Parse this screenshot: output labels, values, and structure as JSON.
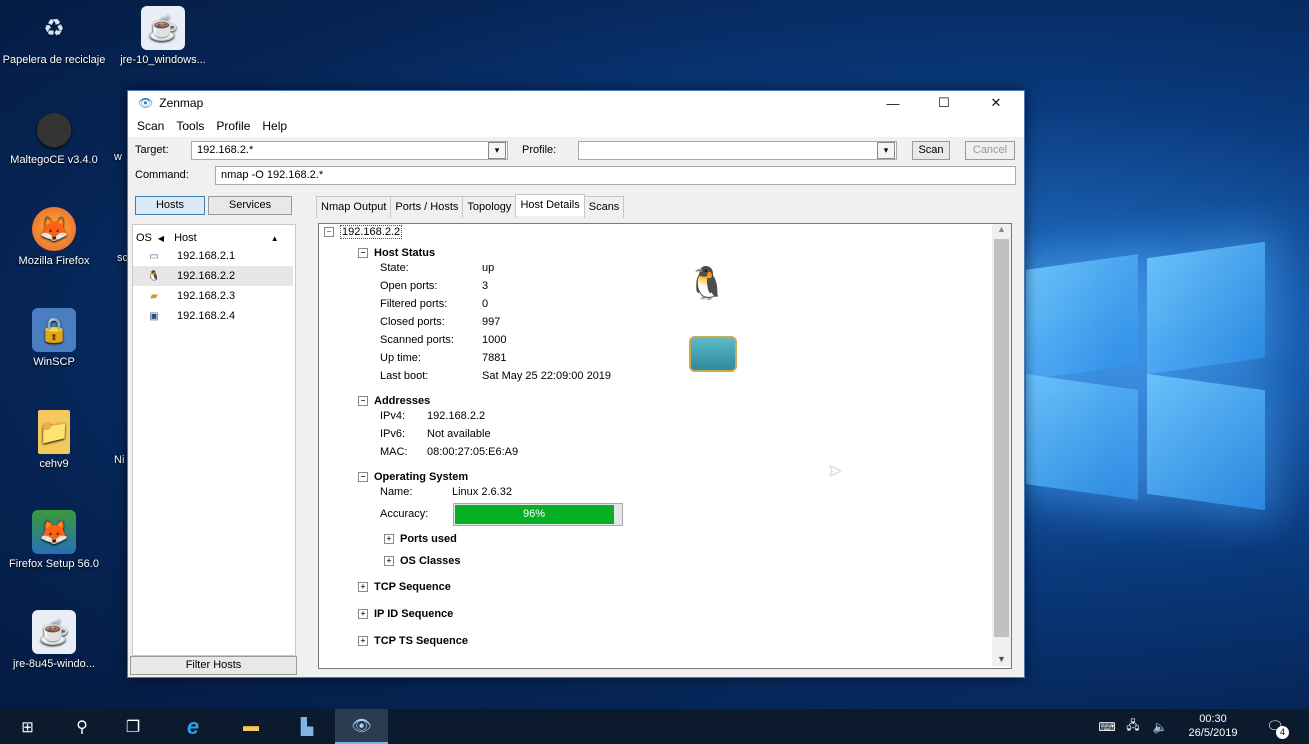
{
  "desktop": {
    "icons": [
      {
        "label": "Papelera de reciclaje",
        "glyph": "♻"
      },
      {
        "label": "jre-10_windows...",
        "glyph": "☕"
      },
      {
        "label": "MaltegoCE v3.4.0",
        "glyph": "⬤"
      },
      {
        "label": "Mozilla Firefox",
        "glyph": "🦊"
      },
      {
        "label": "WinSCP",
        "glyph": "🔒"
      },
      {
        "label": "cehv9",
        "glyph": "📁"
      },
      {
        "label": "Firefox Setup 56.0",
        "glyph": "🦊"
      },
      {
        "label": "jre-8u45-windo...",
        "glyph": "☕"
      }
    ],
    "cut_labels": [
      "w",
      "sc",
      "Ni"
    ]
  },
  "window": {
    "title": "Zenmap",
    "menu": [
      "Scan",
      "Tools",
      "Profile",
      "Help"
    ],
    "target_label": "Target:",
    "target_value": "192.168.2.*",
    "profile_label": "Profile:",
    "profile_value": "",
    "scan_button": "Scan",
    "cancel_button": "Cancel",
    "command_label": "Command:",
    "command_value": "nmap -O 192.168.2.*",
    "hosts_button": "Hosts",
    "services_button": "Services",
    "host_list_header": {
      "os": "OS",
      "host": "Host"
    },
    "hosts": [
      {
        "ip": "192.168.2.1",
        "icon": "monitor-icon"
      },
      {
        "ip": "192.168.2.2",
        "icon": "linux-icon"
      },
      {
        "ip": "192.168.2.3",
        "icon": "wireless-icon"
      },
      {
        "ip": "192.168.2.4",
        "icon": "computer-icon"
      }
    ],
    "filter_button": "Filter Hosts",
    "tabs": [
      "Nmap Output",
      "Ports / Hosts",
      "Topology",
      "Host Details",
      "Scans"
    ],
    "active_tab": "Host Details",
    "details": {
      "host": "192.168.2.2",
      "host_status": {
        "title": "Host Status",
        "rows": [
          {
            "label": "State:",
            "value": "up"
          },
          {
            "label": "Open ports:",
            "value": "3"
          },
          {
            "label": "Filtered ports:",
            "value": "0"
          },
          {
            "label": "Closed ports:",
            "value": "997"
          },
          {
            "label": "Scanned ports:",
            "value": "1000"
          },
          {
            "label": "Up time:",
            "value": "7881"
          },
          {
            "label": "Last boot:",
            "value": "Sat May 25 22:09:00 2019"
          }
        ]
      },
      "addresses": {
        "title": "Addresses",
        "rows": [
          {
            "label": "IPv4:",
            "value": "192.168.2.2"
          },
          {
            "label": "IPv6:",
            "value": "Not available"
          },
          {
            "label": "MAC:",
            "value": "08:00:27:05:E6:A9"
          }
        ]
      },
      "os": {
        "title": "Operating System",
        "name_label": "Name:",
        "name_value": "Linux 2.6.32",
        "accuracy_label": "Accuracy:",
        "accuracy_text": "96%",
        "accuracy": 0.96,
        "ports_used": "Ports used",
        "os_classes": "OS Classes"
      },
      "sections": [
        "TCP Sequence",
        "IP ID Sequence",
        "TCP TS Sequence"
      ]
    }
  },
  "taskbar": {
    "time": "00:30",
    "date": "26/5/2019",
    "notifications": "4"
  }
}
